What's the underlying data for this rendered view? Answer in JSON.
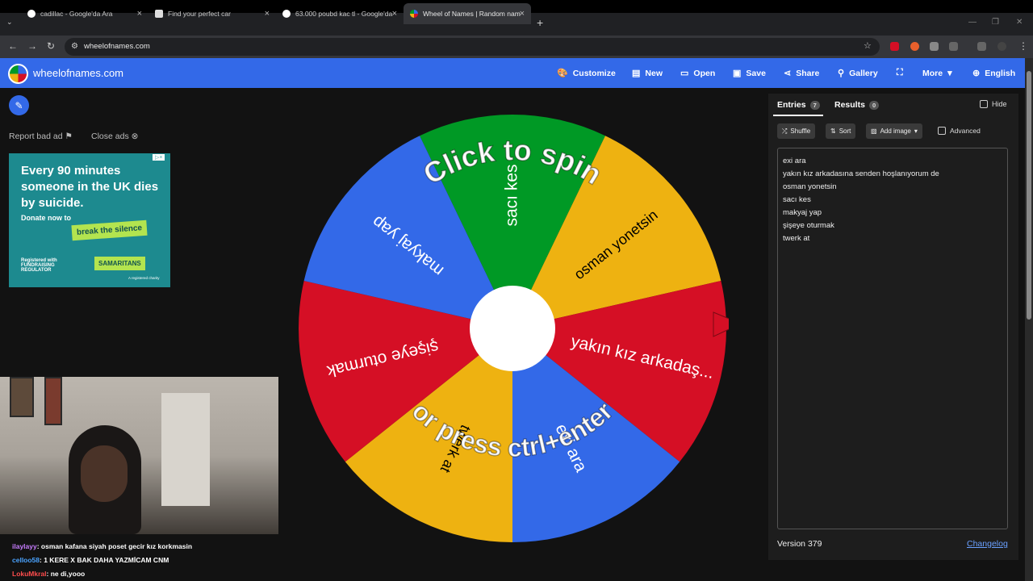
{
  "browser": {
    "tabs": [
      {
        "title": "cadillac - Google'da Ara",
        "icon": "google-icon"
      },
      {
        "title": "Find your perfect car",
        "icon": "page-icon"
      },
      {
        "title": "63.000 poubd kac tl - Google'da",
        "icon": "google-icon"
      },
      {
        "title": "Wheel of Names | Random nam",
        "icon": "wheel-icon"
      }
    ],
    "url": "wheelofnames.com"
  },
  "app": {
    "brand": "wheelofnames.com",
    "menu": {
      "customize": "Customize",
      "new": "New",
      "open": "Open",
      "save": "Save",
      "share": "Share",
      "gallery": "Gallery",
      "more": "More",
      "language": "English"
    }
  },
  "ads": {
    "report": "Report bad ad",
    "close": "Close ads",
    "headline": "Every 90 minutes someone in the UK dies by suicide.",
    "donate": "Donate now to",
    "cta": "break the silence",
    "regulator": "Registered with FUNDRAISING REGULATOR",
    "org": "SAMARITANS",
    "note": "A registered charity"
  },
  "wheel": {
    "prompt_line1": "Click to spin",
    "prompt_line2": "or press ctrl+enter",
    "colors": [
      "#3369e8",
      "#d50f25",
      "#eeb211",
      "#009925"
    ]
  },
  "chart_data": {
    "type": "pie",
    "slices": [
      {
        "label": "sacı kes",
        "color": "#009925",
        "value": 1
      },
      {
        "label": "osman yonetsin",
        "color": "#eeb211",
        "value": 1
      },
      {
        "label": "yakın kız arkadaş...",
        "color": "#d50f25",
        "value": 1
      },
      {
        "label": "exi ara",
        "color": "#3369e8",
        "value": 1
      },
      {
        "label": "twerk at",
        "color": "#eeb211",
        "value": 1
      },
      {
        "label": "şişeye oturmak",
        "color": "#d50f25",
        "value": 1
      },
      {
        "label": "makyaj yap",
        "color": "#3369e8",
        "value": 1
      }
    ]
  },
  "panel": {
    "entries_tab": "Entries",
    "entries_count": "7",
    "results_tab": "Results",
    "results_count": "0",
    "hide": "Hide",
    "shuffle": "Shuffle",
    "sort": "Sort",
    "add_image": "Add image",
    "advanced": "Advanced",
    "entries": [
      "exi ara",
      "yakın kız arkadasına senden hoşlanıyorum de",
      "osman yonetsin",
      "sacı kes",
      "makyaj yap",
      "şişeye oturmak",
      "twerk at"
    ],
    "version": "Version 379",
    "changelog": "Changelog"
  },
  "chat": [
    {
      "user": "ilaylayy",
      "msg": ": osman kafana siyah poset gecir kız korkmasin",
      "color": "#c77dff"
    },
    {
      "user": "celloo58",
      "msg": ": 1 KERE X BAK DAHA YAZMİCAM CNM",
      "color": "#4aa3ff"
    },
    {
      "user": "LokuMkral",
      "msg": ": ne di,yooo",
      "color": "#ff4d4d"
    }
  ]
}
